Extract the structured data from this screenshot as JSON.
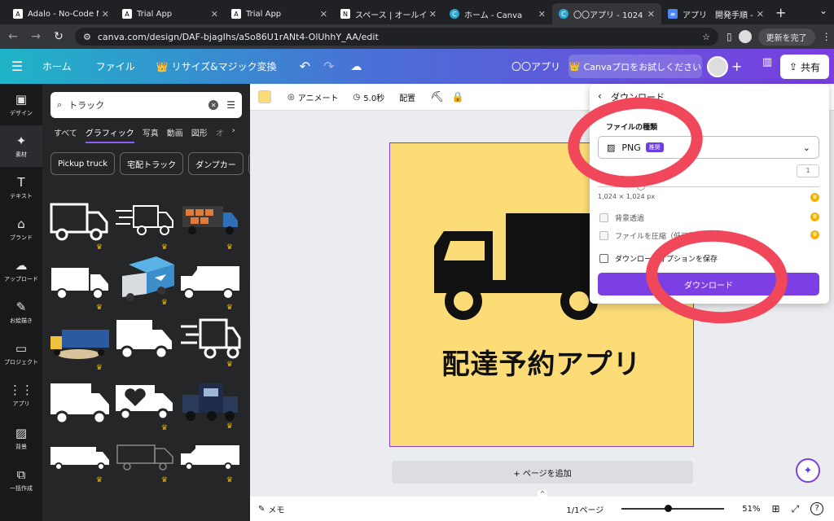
{
  "browser": {
    "tabs": [
      {
        "favicon": "A",
        "title": "Adalo - No-Code Ma"
      },
      {
        "favicon": "A",
        "title": "Trial App"
      },
      {
        "favicon": "A",
        "title": "Trial App"
      },
      {
        "favicon": "N",
        "title": "スペース | オールインワ"
      },
      {
        "favicon": "C",
        "title": "ホーム - Canva"
      },
      {
        "favicon": "C",
        "title": "〇〇アプリ - 1024 × 1"
      },
      {
        "favicon": "≡",
        "title": "アプリ　開発手順 - Go"
      }
    ],
    "url": "canva.com/design/DAF-bjagIhs/aSo86U1rANt4-OlUhhY_AA/edit",
    "update_label": "更新を完了",
    "new_tab": "+"
  },
  "topbar": {
    "home": "ホーム",
    "file": "ファイル",
    "resize": "リサイズ&マジック変換",
    "project_name": "〇〇アプリ",
    "try_pro": "Canvaプロをお試しください",
    "share": "共有"
  },
  "rail": [
    {
      "icon": "▣",
      "label": "デザイン"
    },
    {
      "icon": "✦",
      "label": "素材"
    },
    {
      "icon": "T",
      "label": "テキスト"
    },
    {
      "icon": "⌂",
      "label": "ブランド"
    },
    {
      "icon": "☁",
      "label": "アップロード"
    },
    {
      "icon": "✎",
      "label": "お絵描き"
    },
    {
      "icon": "▭",
      "label": "プロジェクト"
    },
    {
      "icon": "⋮⋮",
      "label": "アプリ"
    },
    {
      "icon": "▨",
      "label": "背景"
    },
    {
      "icon": "⧉",
      "label": "一括作成"
    }
  ],
  "panel": {
    "search_value": "トラック",
    "categories": [
      "すべて",
      "グラフィック",
      "写真",
      "動画",
      "図形",
      "オ"
    ],
    "active_category": "グラフィック",
    "chips": [
      "Pickup truck",
      "宅配トラック",
      "ダンプカー"
    ]
  },
  "toolbar": {
    "animate": "アニメート",
    "duration": "5.0秒",
    "position": "配置"
  },
  "design": {
    "title": "配達予約アプリ",
    "bg_color": "#fbdc77"
  },
  "canvas": {
    "add_page": "+ ページを追加"
  },
  "bottom": {
    "memo": "メモ",
    "page": "1/1ページ",
    "zoom": "51%",
    "zoom_level": 0.45
  },
  "download_panel": {
    "header": "ダウンロード",
    "file_type_label": "ファイルの種類",
    "file_type": "PNG",
    "badge": "推奨",
    "count": "1",
    "size": "1,024 × 1,024 px",
    "options": [
      "背景透過",
      "ファイルを圧縮（低画質）",
      "ダウンロードオプションを保存"
    ],
    "button": "ダウンロード"
  },
  "colors": {
    "accent": "#7b3fe4",
    "annotation": "#f0485a"
  }
}
